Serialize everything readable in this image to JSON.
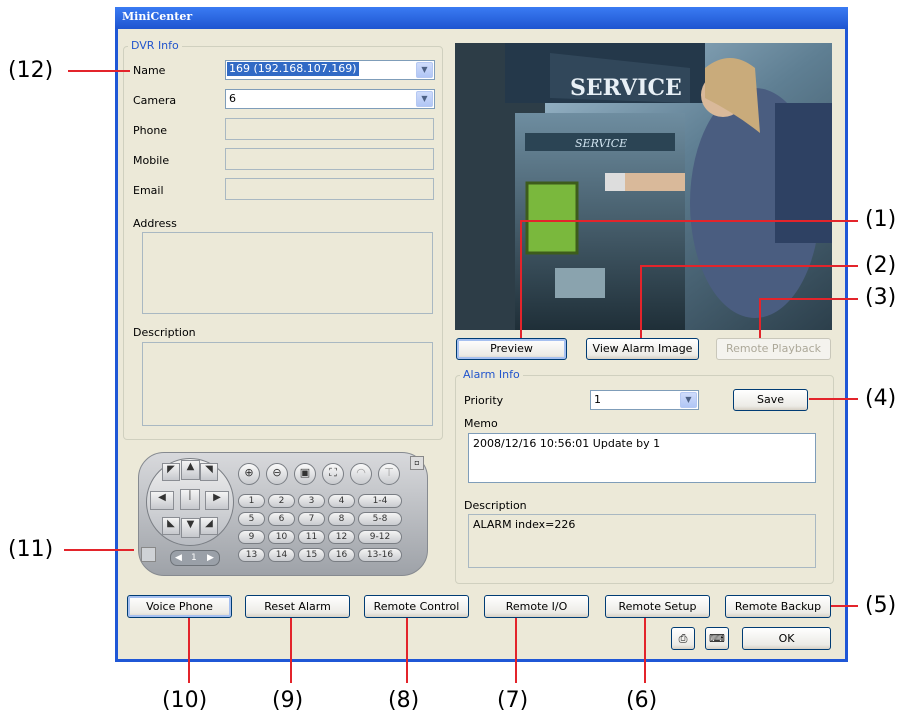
{
  "window": {
    "title": "MiniCenter"
  },
  "dvr_info": {
    "group_title": "DVR Info",
    "name_label": "Name",
    "name_value": "169 (192.168.107.169)",
    "camera_label": "Camera",
    "camera_value": "6",
    "phone_label": "Phone",
    "mobile_label": "Mobile",
    "email_label": "Email",
    "address_label": "Address",
    "description_label": "Description"
  },
  "preview_image": {
    "sign_text": "SERVICE",
    "sign_text2": "SERVICE"
  },
  "image_buttons": {
    "preview": "Preview",
    "view_alarm": "View Alarm Image",
    "remote_playback": "Remote Playback"
  },
  "alarm_info": {
    "group_title": "Alarm Info",
    "priority_label": "Priority",
    "priority_value": "1",
    "save_label": "Save",
    "memo_label": "Memo",
    "memo_value": "2008/12/16 10:56:01  Update by 1",
    "description_label": "Description",
    "description_value": "ALARM index=226"
  },
  "ptz": {
    "number_keys": [
      "1",
      "2",
      "3",
      "4",
      "1-4",
      "5",
      "6",
      "7",
      "8",
      "5-8",
      "9",
      "10",
      "11",
      "12",
      "9-12",
      "13",
      "14",
      "15",
      "16",
      "13-16"
    ],
    "page_indicator": "1"
  },
  "bottom_buttons": {
    "voice_phone": "Voice Phone",
    "reset_alarm": "Reset Alarm",
    "remote_control": "Remote Control",
    "remote_io": "Remote I/O",
    "remote_setup": "Remote Setup",
    "remote_backup": "Remote Backup",
    "ok": "OK"
  },
  "annotations": {
    "a1": "(1)",
    "a2": "(2)",
    "a3": "(3)",
    "a4": "(4)",
    "a5": "(5)",
    "a6": "(6)",
    "a7": "(7)",
    "a8": "(8)",
    "a9": "(9)",
    "a10": "(10)",
    "a11": "(11)",
    "a12": "(12)"
  }
}
